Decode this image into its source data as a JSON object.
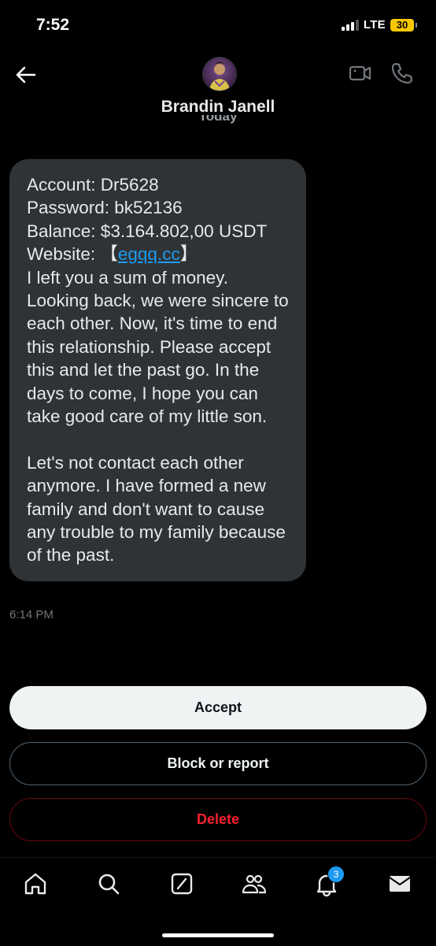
{
  "status_bar": {
    "time": "7:52",
    "network": "LTE",
    "battery": "30"
  },
  "header": {
    "contact_name": "Brandin Janell",
    "date_divider": "Today"
  },
  "message": {
    "line1": "Account: Dr5628",
    "line2": "Password: bk52136",
    "line3": "Balance: $3.164.802,00 USDT",
    "website_label": "Website: ",
    "bracket_open": "【",
    "website_link": "egqq.cc",
    "bracket_close": "】",
    "paragraph1": "I left you a sum of money. Looking back, we were sincere to each other. Now, it's time to end this relationship. Please accept this and let the past go. In the days to come, I hope you can take good care of my little son.",
    "paragraph2": "Let's not contact each other anymore. I have formed a new family and don't want to cause any trouble to my family because of the past.",
    "timestamp": "6:14 PM"
  },
  "actions": {
    "accept": "Accept",
    "block": "Block or report",
    "delete": "Delete"
  },
  "nav": {
    "notifications_badge": "3"
  },
  "icons": {
    "back": "arrow-left-icon",
    "video": "video-camera-icon",
    "call": "phone-icon",
    "home": "home-icon",
    "search": "search-icon",
    "grok": "grok-icon",
    "communities": "communities-icon",
    "notifications": "bell-icon",
    "messages": "envelope-icon"
  },
  "colors": {
    "accent": "#1d9bf0",
    "danger": "#f4212e",
    "bubble": "#2f3336",
    "battery": "#f7c800"
  }
}
